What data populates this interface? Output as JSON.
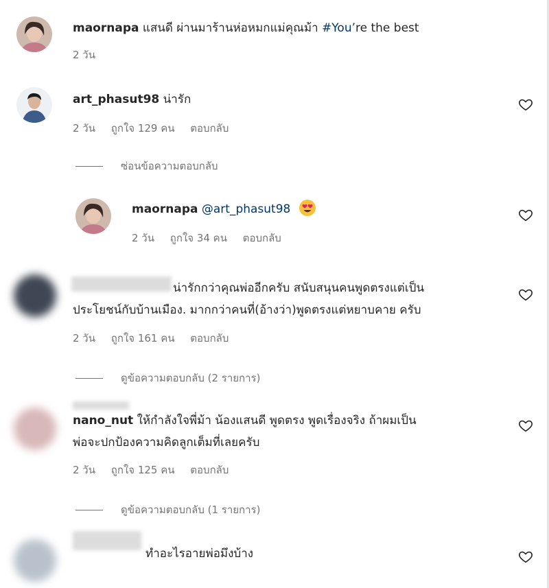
{
  "colors": {
    "text": "#262626",
    "meta": "#737373",
    "link": "#00376b"
  },
  "comments": [
    {
      "username": "maornapa",
      "text": "แสนดี ผ่านมาร้านห่อหมกแม่คุณม้า",
      "hashtag": "#You",
      "text_after": "’re the best",
      "time": "2 วัน"
    },
    {
      "username": "art_phasut98",
      "text": "น่ารัก",
      "time": "2 วัน",
      "likes": "ถูกใจ 129 คน",
      "reply": "ตอบกลับ",
      "thread_toggle": "ซ่อนข้อความตอบกลับ"
    },
    {
      "username": "maornapa",
      "mention": "@art_phasut98",
      "emoji": "heart-eyes-emoji",
      "time": "2 วัน",
      "likes": "ถูกใจ 34 คน",
      "reply": "ตอบกลับ"
    },
    {
      "text_line1": "น่ารักกว่าคุณพ่ออีกครับ สนับสนุนคนพูดตรงแต่เป็น",
      "text_line2": "ประโยชน์กับบ้านเมือง. มากกว่าคนที่(อ้างว่า)พูดตรงแต่หยาบคาย ครับ",
      "time": "2 วัน",
      "likes": "ถูกใจ 161 คน",
      "reply": "ตอบกลับ",
      "thread_toggle": "ดูข้อความตอบกลับ (2 รายการ)"
    },
    {
      "username": "nano_nut",
      "text_line1": "ให้กำลังใจพี่ม้า น้องแสนดี พูดตรง พูดเรื่องจริง ถ้าผมเป็น",
      "text_line2": "พ่อจะปกป้องความคิดลูกเต็มที่เลยครับ",
      "time": "2 วัน",
      "likes": "ถูกใจ 125 คน",
      "reply": "ตอบกลับ",
      "thread_toggle": "ดูข้อความตอบกลับ (1 รายการ)"
    },
    {
      "text": "ทำอะไรอายพ่อมึงบ้าง"
    }
  ]
}
